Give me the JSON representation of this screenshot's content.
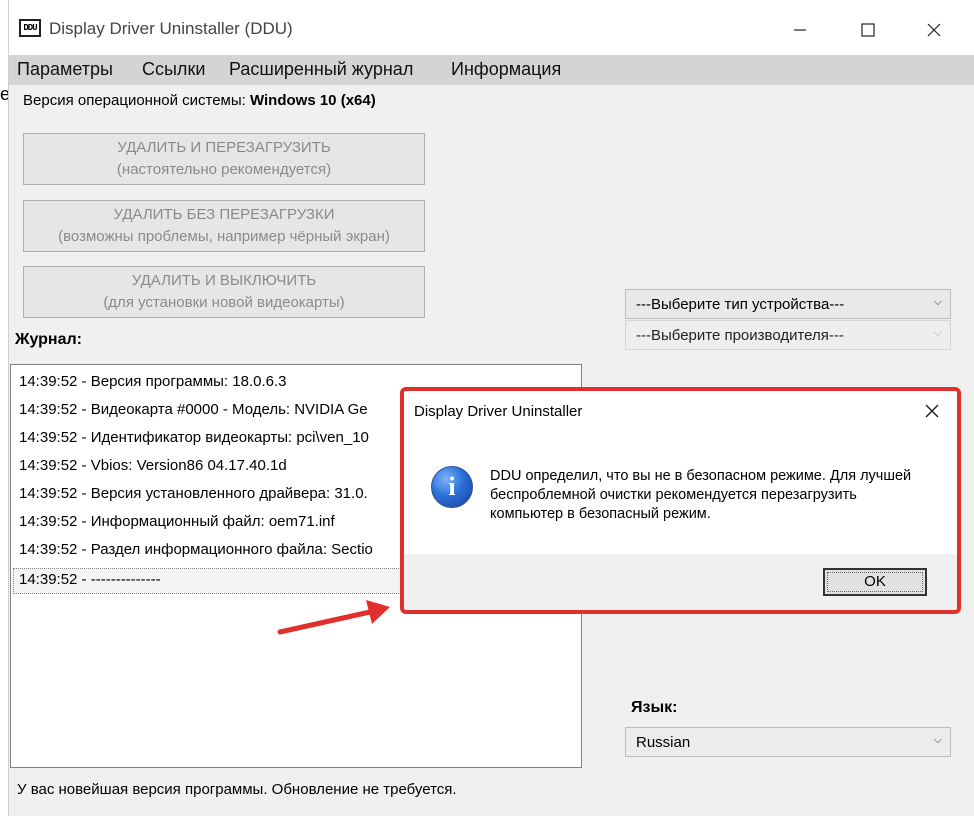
{
  "window": {
    "icon_text": "DDU",
    "title": "Display Driver Uninstaller (DDU)"
  },
  "menu": [
    "Параметры",
    "Ссылки",
    "Расширенный журнал",
    "Информация"
  ],
  "cut_letter": "e",
  "os": {
    "label": "Версия операционной системы: ",
    "value": "Windows 10 (x64)"
  },
  "buttons": [
    {
      "line1": "УДАЛИТЬ И ПЕРЕЗАГРУЗИТЬ",
      "line2": "(настоятельно рекомендуется)"
    },
    {
      "line1": "УДАЛИТЬ БЕЗ ПЕРЕЗАГРУЗКИ",
      "line2": "(возможны проблемы, например чёрный экран)"
    },
    {
      "line1": "УДАЛИТЬ И ВЫКЛЮЧИТЬ",
      "line2": "(для установки новой видеокарты)"
    }
  ],
  "log": {
    "label": "Журнал:",
    "lines": [
      "14:39:52 - Версия программы: 18.0.6.3",
      "14:39:52 - Видеокарта #0000 - Модель: NVIDIA Ge",
      "14:39:52 - Идентификатор видеокарты: pci\\ven_10",
      "14:39:52 - Vbios: Version86 04.17.40.1d",
      "14:39:52 - Версия установленного драйвера: 31.0.",
      "14:39:52 - Информационный файл: oem71.inf",
      "14:39:52 - Раздел информационного файла: Sectio",
      "14:39:52 - --------------"
    ]
  },
  "device_type": {
    "value": "---Выберите тип устройства---"
  },
  "vendor": {
    "value": "---Выберите производителя---"
  },
  "language": {
    "label": "Язык:",
    "value": "Russian"
  },
  "status": "У вас новейшая версия программы. Обновление не требуется.",
  "dialog": {
    "title": "Display Driver Uninstaller",
    "message": "DDU определил, что вы не в безопасном режиме. Для лучшей беспроблемной очистки рекомендуется перезагрузить компьютер в безопасный режим.",
    "ok_label": "OK",
    "icon": "information-icon"
  },
  "colors": {
    "highlight": "#e0302c",
    "menubar": "#d4d4d4",
    "window_bg": "#f0f0f0"
  }
}
